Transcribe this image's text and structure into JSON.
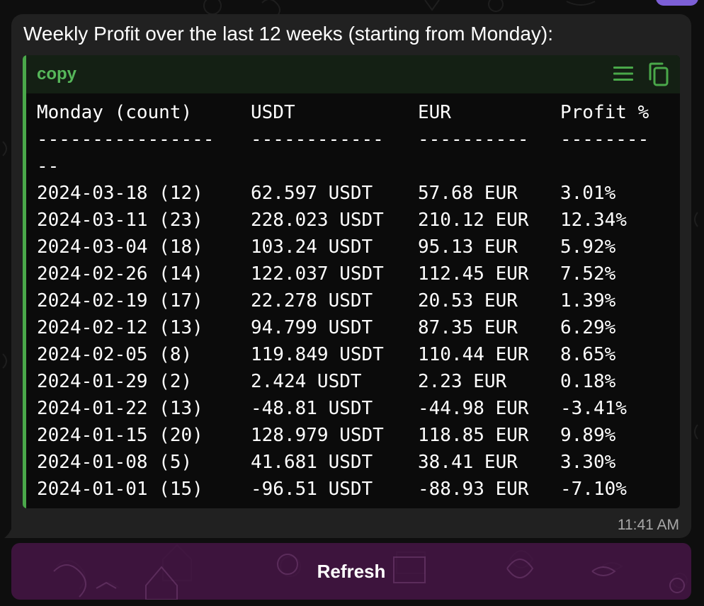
{
  "message": {
    "title": "Weekly Profit over the last 12 weeks (starting from Monday):",
    "timestamp": "11:41 AM",
    "code_block": {
      "language": "copy",
      "header_row": [
        "Monday (count)",
        "USDT",
        "EUR",
        "Profit %"
      ],
      "separator_row": [
        "----------------",
        "------------",
        "----------",
        "--------"
      ],
      "separator_wrap": "--",
      "rows": [
        [
          "2024-03-18 (12)",
          "62.597 USDT",
          "57.68 EUR",
          "3.01%"
        ],
        [
          "2024-03-11 (23)",
          "228.023 USDT",
          "210.12 EUR",
          "12.34%"
        ],
        [
          "2024-03-04 (18)",
          "103.24 USDT",
          "95.13 EUR",
          "5.92%"
        ],
        [
          "2024-02-26 (14)",
          "122.037 USDT",
          "112.45 EUR",
          "7.52%"
        ],
        [
          "2024-02-19 (17)",
          "22.278 USDT",
          "20.53 EUR",
          "1.39%"
        ],
        [
          "2024-02-12 (13)",
          "94.799 USDT",
          "87.35 EUR",
          "6.29%"
        ],
        [
          "2024-02-05 (8)",
          "119.849 USDT",
          "110.44 EUR",
          "8.65%"
        ],
        [
          "2024-01-29 (2)",
          "2.424 USDT",
          "2.23 EUR",
          "0.18%"
        ],
        [
          "2024-01-22 (13)",
          "-48.81 USDT",
          "-44.98 EUR",
          "-3.41%"
        ],
        [
          "2024-01-15 (20)",
          "128.979 USDT",
          "118.85 EUR",
          "9.89%"
        ],
        [
          "2024-01-08 (5)",
          "41.681 USDT",
          "38.41 EUR",
          "3.30%"
        ],
        [
          "2024-01-01 (15)",
          "-96.51 USDT",
          "-88.93 EUR",
          "-7.10%"
        ]
      ],
      "icons": {
        "menu": "hamburger-menu-icon",
        "copy": "copy-icon"
      }
    }
  },
  "keyboard": {
    "refresh_label": "Refresh"
  },
  "colors": {
    "background": "#0e0e0e",
    "bubble": "#212121",
    "code_background": "#0b0b0b",
    "code_header": "#142014",
    "code_accent": "#4aa84a",
    "button": "#481648",
    "timestamp": "#a8a8a8"
  }
}
